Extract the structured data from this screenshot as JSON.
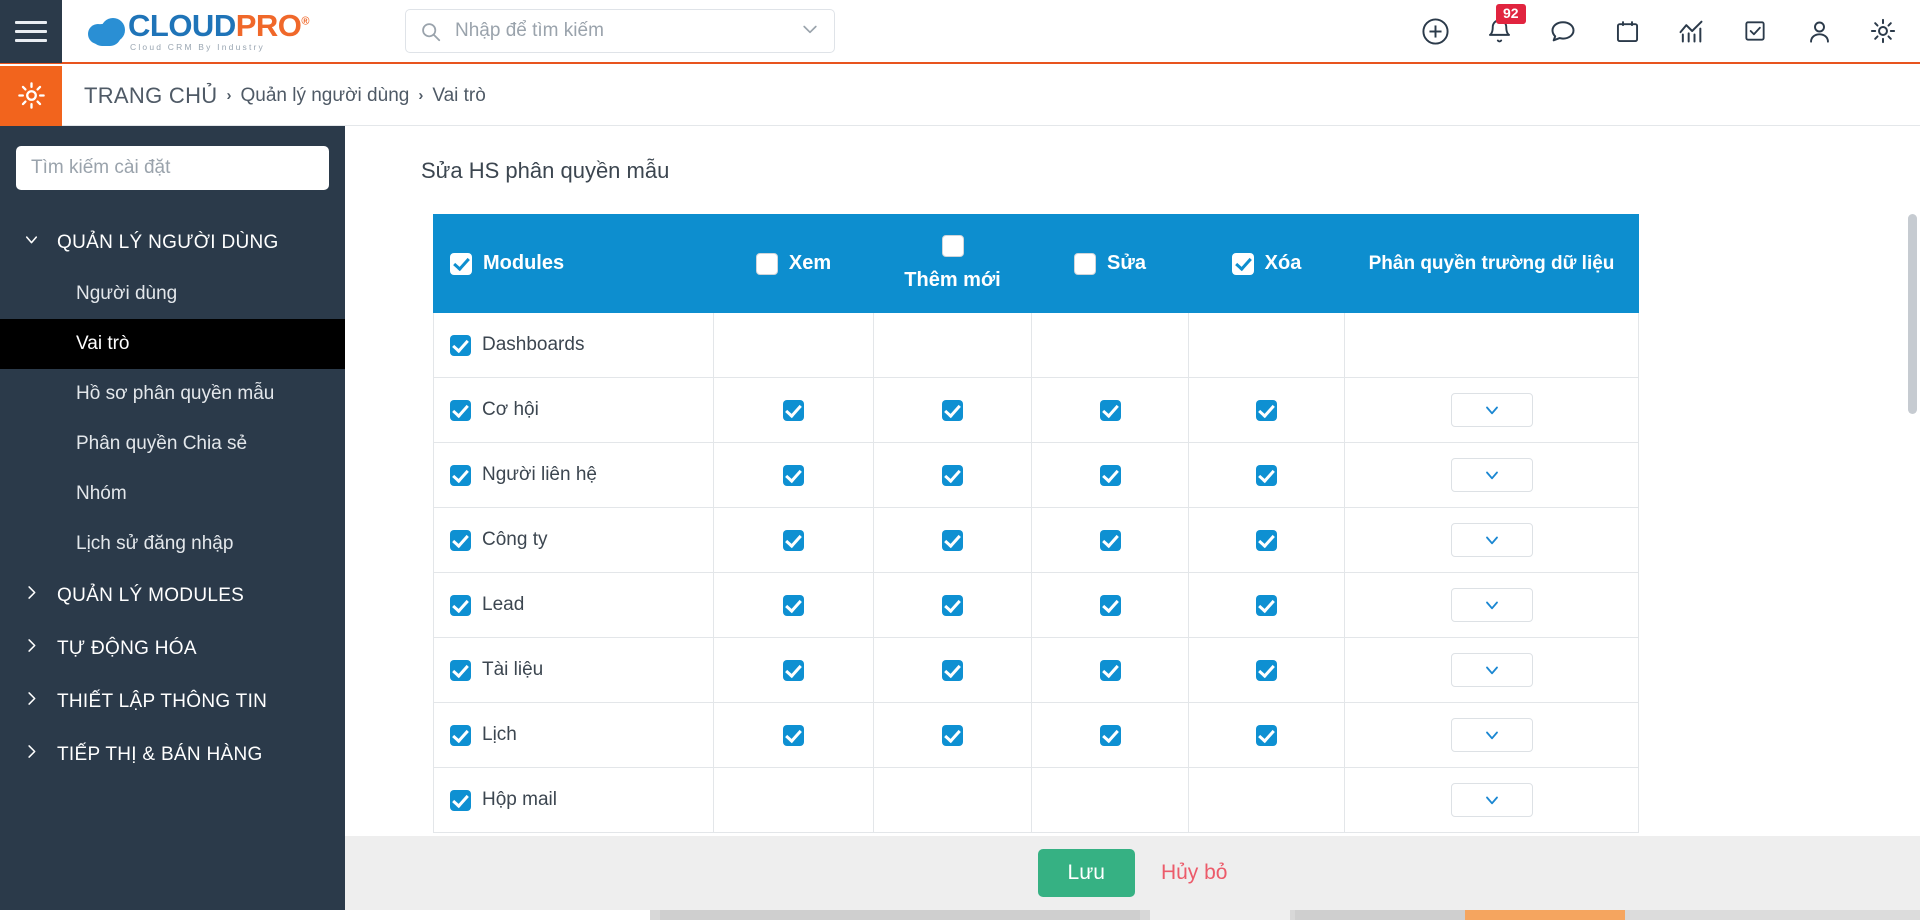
{
  "topbar": {
    "menu_icon": "hamburger-icon",
    "logo": {
      "cloud": "CLOUD",
      "pro": "PRO",
      "reg": "®",
      "tagline": "Cloud CRM By Industry"
    },
    "search": {
      "placeholder": "Nhập để tìm kiếm",
      "value": "",
      "icon": "search-icon",
      "caret": "chevron-down-icon"
    },
    "icons": [
      {
        "name": "add-circle-icon",
        "badge": ""
      },
      {
        "name": "bell-icon",
        "badge": "92"
      },
      {
        "name": "chat-bubble-icon",
        "badge": ""
      },
      {
        "name": "calendar-icon",
        "badge": ""
      },
      {
        "name": "analytics-icon",
        "badge": ""
      },
      {
        "name": "task-check-icon",
        "badge": ""
      },
      {
        "name": "user-icon",
        "badge": ""
      },
      {
        "name": "gear-icon",
        "badge": ""
      }
    ],
    "badge_count": "92"
  },
  "breadcrumb": {
    "gear_icon": "gear-icon",
    "home": "TRANG CHỦ",
    "separator": "›",
    "items": [
      "Quản lý người dùng",
      "Vai trò"
    ]
  },
  "sidebar": {
    "search_placeholder": "Tìm kiếm cài đặt",
    "search_value": "",
    "groups": [
      {
        "label": "QUẢN LÝ NGƯỜI DÙNG",
        "expanded": true,
        "icon": "chevron-down-icon"
      },
      {
        "label": "QUẢN LÝ MODULES",
        "expanded": false,
        "icon": "chevron-right-icon"
      },
      {
        "label": "TỰ ĐỘNG HÓA",
        "expanded": false,
        "icon": "chevron-right-icon"
      },
      {
        "label": "THIẾT LẬP THÔNG TIN",
        "expanded": false,
        "icon": "chevron-right-icon"
      },
      {
        "label": "TIẾP THỊ & BÁN HÀNG",
        "expanded": false,
        "icon": "chevron-right-icon"
      }
    ],
    "sub_items": [
      {
        "label": "Người dùng",
        "active": false
      },
      {
        "label": "Vai trò",
        "active": true
      },
      {
        "label": "Hồ sơ phân quyền mẫu",
        "active": false
      },
      {
        "label": "Phân quyền Chia sẻ",
        "active": false
      },
      {
        "label": "Nhóm",
        "active": false
      },
      {
        "label": "Lịch sử đăng nhập",
        "active": false
      }
    ]
  },
  "main": {
    "page_title": "Sửa HS phân quyền mẫu",
    "table": {
      "columns": [
        {
          "key": "modules",
          "label": "Modules",
          "checkbox": true,
          "checked": true
        },
        {
          "key": "view",
          "label": "Xem",
          "checkbox": true,
          "checked": false
        },
        {
          "key": "create",
          "label": "Thêm mới",
          "checkbox": true,
          "checked": false
        },
        {
          "key": "edit",
          "label": "Sửa",
          "checkbox": true,
          "checked": false
        },
        {
          "key": "delete",
          "label": "Xóa",
          "checkbox": true,
          "checked": true
        },
        {
          "key": "fields",
          "label": "Phân quyền trường dữ liệu",
          "checkbox": false,
          "checked": false
        }
      ],
      "rows": [
        {
          "module": "Dashboards",
          "checked": true,
          "view": null,
          "create": null,
          "edit": null,
          "delete": null,
          "fields": false
        },
        {
          "module": "Cơ hội",
          "checked": true,
          "view": true,
          "create": true,
          "edit": true,
          "delete": true,
          "fields": true
        },
        {
          "module": "Người liên hệ",
          "checked": true,
          "view": true,
          "create": true,
          "edit": true,
          "delete": true,
          "fields": true
        },
        {
          "module": "Công ty",
          "checked": true,
          "view": true,
          "create": true,
          "edit": true,
          "delete": true,
          "fields": true
        },
        {
          "module": "Lead",
          "checked": true,
          "view": true,
          "create": true,
          "edit": true,
          "delete": true,
          "fields": true
        },
        {
          "module": "Tài liệu",
          "checked": true,
          "view": true,
          "create": true,
          "edit": true,
          "delete": true,
          "fields": true
        },
        {
          "module": "Lịch",
          "checked": true,
          "view": true,
          "create": true,
          "edit": true,
          "delete": true,
          "fields": true
        },
        {
          "module": "Hộp mail",
          "checked": true,
          "view": null,
          "create": null,
          "edit": null,
          "delete": null,
          "fields": true
        }
      ],
      "dropdown_icon": "chevron-down-icon"
    }
  },
  "footer": {
    "save_label": "Lưu",
    "cancel_label": "Hủy bỏ",
    "save_color": "#36b183",
    "cancel_color": "#ec5b6a"
  },
  "colors": {
    "header_blue": "#0d8ecf",
    "sidebar_dark": "#2b3a4a",
    "accent_orange": "#f2641d",
    "badge_red": "#e1243f"
  }
}
